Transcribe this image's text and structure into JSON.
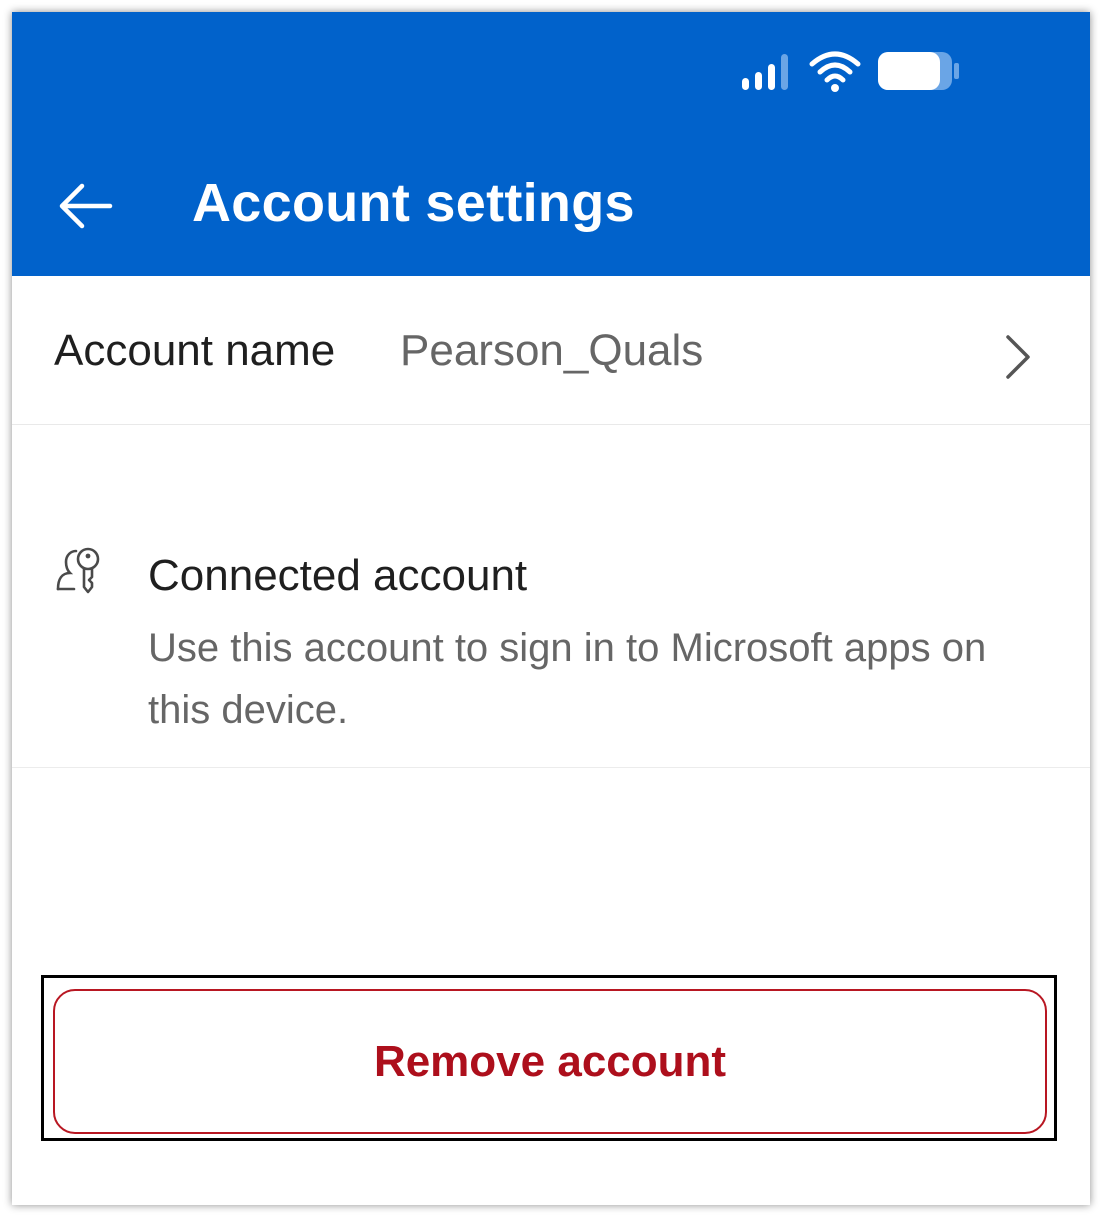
{
  "header": {
    "title": "Account settings",
    "back_icon": "arrow-left-icon",
    "background": "#0162cb"
  },
  "status_bar": {
    "icons": [
      "signal-icon",
      "wifi-icon",
      "battery-icon"
    ]
  },
  "account_name": {
    "label": "Account name",
    "value": "Pearson_Quals",
    "icon": "chevron-right-icon"
  },
  "connected_account": {
    "icon": "person-key-icon",
    "title": "Connected account",
    "description": "Use this account to sign in to Microsoft apps on this device."
  },
  "remove_button": {
    "label": "Remove account",
    "color": "#ad0f1c"
  }
}
